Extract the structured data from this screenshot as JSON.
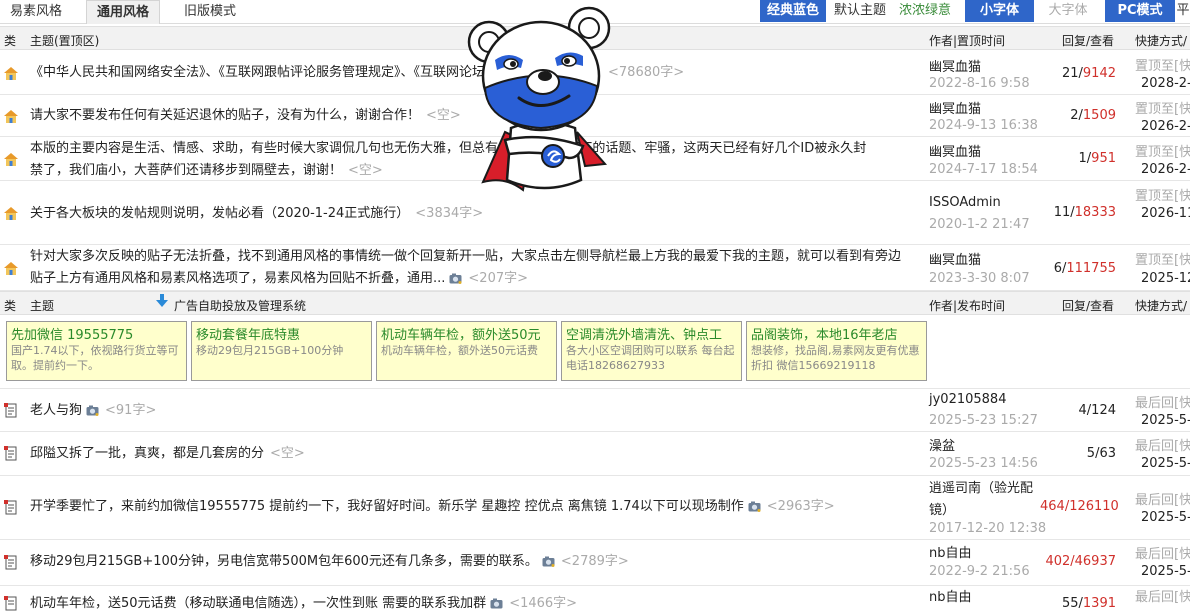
{
  "tabs": [
    "易素风格",
    "通用风格",
    "旧版模式"
  ],
  "switches": {
    "theme_classic": "经典蓝色",
    "theme_default": "默认主题",
    "theme_green": "浓浓绿意",
    "font_small": "小字体",
    "font_large": "大字体",
    "pc_mode": "PC模式",
    "flat": "平"
  },
  "pinned_header": {
    "type": "类",
    "topic": "主题(置顶区)",
    "author": "作者|置顶时间",
    "reply": "回复/查看",
    "quick": "快捷方式/"
  },
  "pinned_rows": [
    {
      "title": "《中华人民共和国网络安全法》、《互联网跟帖评论服务管理规定》、《互联网论坛社区服务管理规定》",
      "size": "<78680字>",
      "author": "幽冥血猫",
      "date": "2022-8-16 9:58",
      "reply": "21/",
      "views": "9142",
      "quick": "置顶至[快",
      "qdate": "2028-2-"
    },
    {
      "title": "请大家不要发布任何有关延迟退休的贴子，没有为什么，谢谢合作！",
      "size": "<空>",
      "author": "幽冥血猫",
      "date": "2024-9-13 16:38",
      "reply": "2/",
      "views": "1509",
      "quick": "置顶至[快",
      "qdate": "2026-2-2"
    },
    {
      "title": "本版的主要内容是生活、情感、求助，有些时候大家调侃几句也无伤大雅，但总有一些人发布对ZF的话题、牢骚，这两天已经有好几个ID被永久封",
      "title2": "禁了，我们庙小，大菩萨们还请移步到隔壁去，谢谢！",
      "size": "<空>",
      "author": "幽冥血猫",
      "date": "2024-7-17 18:54",
      "reply": "1/",
      "views": "951",
      "quick": "置顶至[快",
      "qdate": "2026-2-1"
    },
    {
      "title": "关于各大板块的发帖规则说明，发帖必看（2020-1-24正式施行）",
      "size": "<3834字>",
      "author": "ISSOAdmin",
      "date": "2020-1-2 21:47",
      "reply": "11/",
      "views": "18333",
      "quick": "置顶至[快",
      "qdate": "2026-11-"
    },
    {
      "title": "针对大家多次反映的贴子无法折叠，找不到通用风格的事情统一做个回复新开一贴，大家点击左侧导航栏最上方我的最爱下我的主题，就可以看到有旁边",
      "title2": "贴子上方有通用风格和易素风格选项了，易素风格为回贴不折叠，通用...",
      "size": "<207字>",
      "author": "幽冥血猫",
      "date": "2023-3-30 8:07",
      "reply": "6/",
      "views": "111755",
      "quick": "置顶至[快",
      "qdate": "2025-12-"
    }
  ],
  "normal_header": {
    "type": "类",
    "topic": "主题",
    "ad_label": "广告自助投放及管理系统",
    "author": "作者|发布时间",
    "reply": "回复/查看",
    "quick": "快捷方式/"
  },
  "ads": [
    {
      "title": "先加微信 19555775",
      "body": "国产1.74以下，依视路行货立等可取。提前约一下。"
    },
    {
      "title": "移动套餐年底特惠",
      "body": "移动29包月215GB+100分钟"
    },
    {
      "title": "机动车辆年检，额外送50元",
      "body": "机动车辆年检，额外送50元话费"
    },
    {
      "title": "空调清洗外墙清洗、钟点工",
      "body": "各大小区空调团购可以联系 每台起电话18268627933"
    },
    {
      "title": "品阁装饰，本地16年老店",
      "body": "想装修，找品阁,易素网友更有优惠折扣 微信15669219118"
    }
  ],
  "rows": [
    {
      "title": "老人与狗",
      "size": "<91字>",
      "author": "jy02105884",
      "date": "2025-5-23 15:27",
      "reply": "4/",
      "views": "124",
      "quick": "最后回[快",
      "qdate": "2025-5-2",
      "hot": false
    },
    {
      "title": "邱隘又拆了一批，真爽，都是几套房的分",
      "size": "<空>",
      "author": "澡盆",
      "date": "2025-5-23 14:56",
      "reply": "5/",
      "views": "63",
      "quick": "最后回[快",
      "qdate": "2025-5-2",
      "hot": false
    },
    {
      "title": "开学季要忙了，来前约加微信19555775 提前约一下，我好留好时间。新乐学 星趣控 控优点 离焦镜 1.74以下可以现场制作",
      "size": "<2963字>",
      "author": "逍遥司南（验光配",
      "author2": "镜）",
      "date": "2017-12-20 12:38",
      "reply": "464/",
      "views": "126110",
      "quick": "最后回[快",
      "qdate": "2025-5-2",
      "hot": true
    },
    {
      "title": "移动29包月215GB+100分钟，另电信宽带500M包年600元还有几条多，需要的联系。",
      "size": "<2789字>",
      "author": "nb自由",
      "date": "2022-9-2 21:56",
      "reply": "402/",
      "views": "46937",
      "quick": "最后回[快",
      "qdate": "2025-5-2",
      "hot": true
    },
    {
      "title": "机动车年检，送50元话费（移动联通电信随选），一次性到账 需要的联系我加群",
      "size": "<1466字>",
      "author": "nb自由",
      "date": "",
      "reply": "55/",
      "views": "1391",
      "quick": "最后回[快",
      "qdate": "",
      "hot": false
    }
  ],
  "colors": {
    "accent_blue": "#2f66c9",
    "red": "#d0302b",
    "ad_bg": "#ffffcc"
  }
}
